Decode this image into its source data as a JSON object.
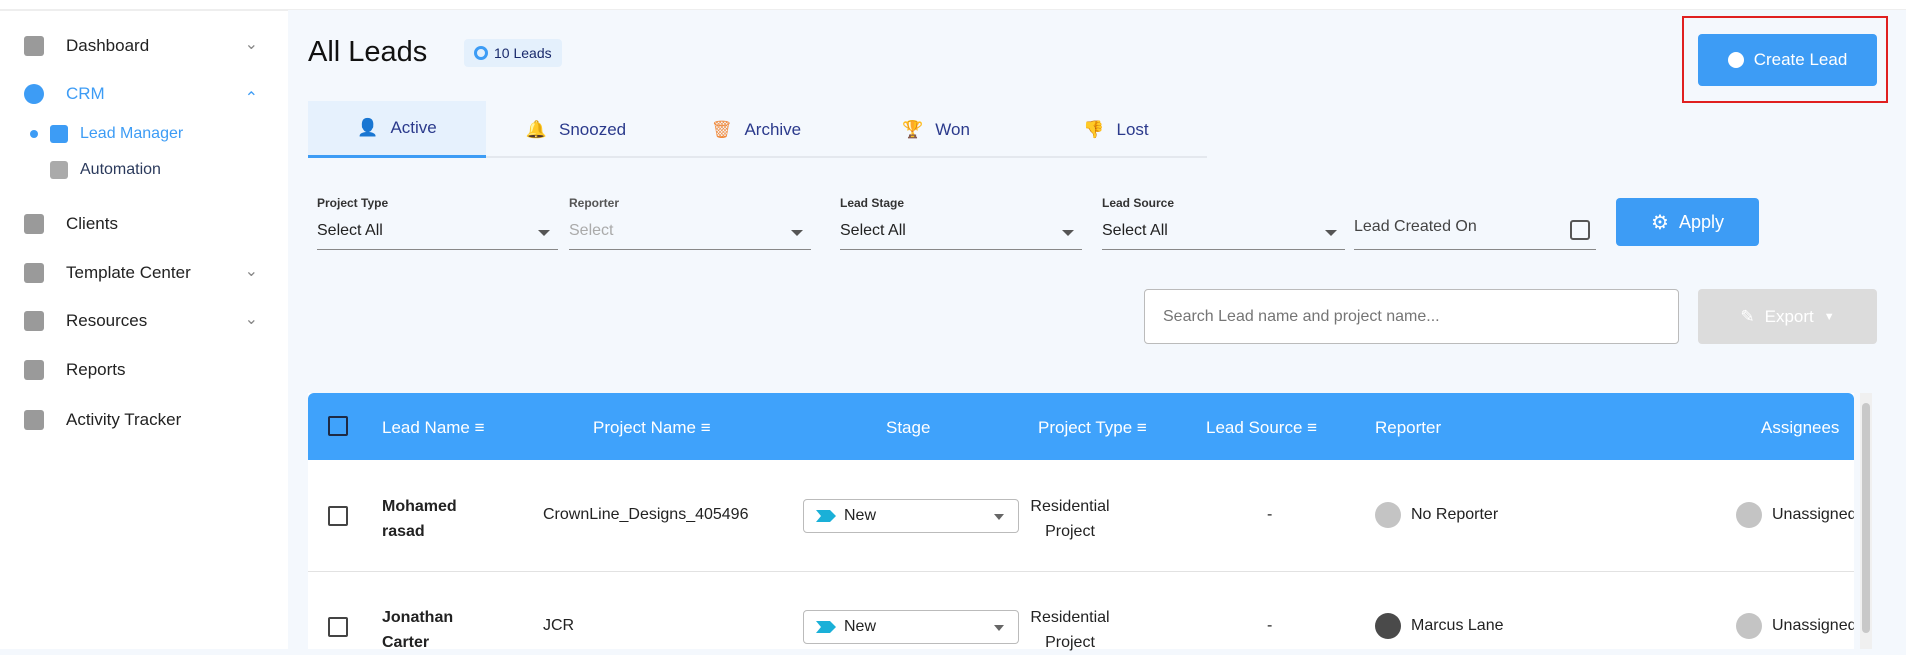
{
  "sidebar": {
    "items": [
      {
        "label": "Dashboard",
        "icon": "dashboard-icon",
        "expandable": true
      },
      {
        "label": "CRM",
        "icon": "crm-icon",
        "expanded": true
      },
      {
        "label": "Lead Manager",
        "icon": "lead-manager-icon",
        "active": true
      },
      {
        "label": "Automation",
        "icon": "automation-icon"
      },
      {
        "label": "Clients",
        "icon": "clients-icon"
      },
      {
        "label": "Template Center",
        "icon": "template-icon",
        "expandable": true
      },
      {
        "label": "Resources",
        "icon": "resources-icon",
        "expandable": true
      },
      {
        "label": "Reports",
        "icon": "reports-icon"
      },
      {
        "label": "Activity Tracker",
        "icon": "activity-icon"
      }
    ]
  },
  "header": {
    "title": "All Leads",
    "count_badge": "10 Leads",
    "create_button": "Create Lead"
  },
  "tabs": [
    {
      "label": "Active"
    },
    {
      "label": "Snoozed"
    },
    {
      "label": "Archive"
    },
    {
      "label": "Won"
    },
    {
      "label": "Lost"
    }
  ],
  "filters": {
    "project_type": {
      "label": "Project Type",
      "value": "Select All"
    },
    "reporter": {
      "label": "Reporter",
      "placeholder": "Select"
    },
    "lead_stage": {
      "label": "Lead Stage",
      "value": "Select All"
    },
    "lead_source": {
      "label": "Lead Source",
      "value": "Select All"
    },
    "lead_created_on": {
      "placeholder": "Lead Created On"
    },
    "apply_button": "Apply"
  },
  "search": {
    "placeholder": "Search Lead name and project name..."
  },
  "export_button": "Export",
  "table": {
    "columns": [
      "Lead Name",
      "Project Name",
      "Stage",
      "Project Type",
      "Lead Source",
      "Reporter",
      "Assignees"
    ],
    "rows": [
      {
        "lead_name_1": "Mohamed",
        "lead_name_2": "rasad",
        "project_name": "CrownLine_Designs_405496",
        "stage": "New",
        "project_type_1": "Residential",
        "project_type_2": "Project",
        "lead_source": "-",
        "reporter": "No Reporter",
        "assignees": "Unassigned"
      },
      {
        "lead_name_1": "Jonathan",
        "lead_name_2": "Carter",
        "project_name": "JCR",
        "stage": "New",
        "project_type_1": "Residential",
        "project_type_2": "Project",
        "lead_source": "-",
        "reporter": "Marcus Lane",
        "assignees": "Unassigned"
      }
    ]
  },
  "colors": {
    "accent": "#3d9cf5",
    "highlight": "#e02020"
  }
}
